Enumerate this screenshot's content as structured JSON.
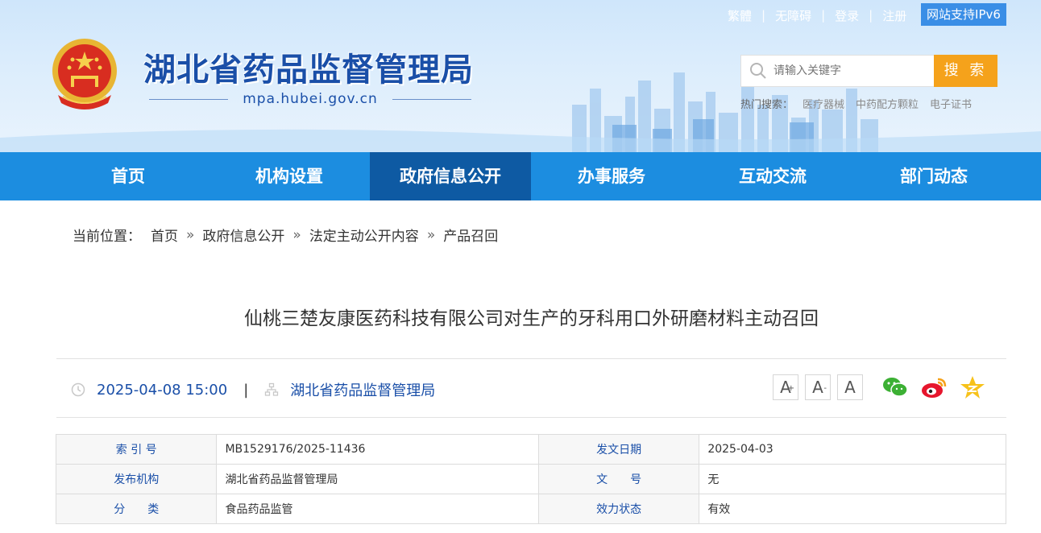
{
  "header": {
    "top_links": [
      "繁體",
      "无障碍",
      "登录",
      "注册"
    ],
    "ipv6": "网站支持IPv6",
    "site_title": "湖北省药品监督管理局",
    "domain": "mpa.hubei.gov.cn",
    "search": {
      "placeholder": "请输入关键字",
      "button": "搜 索"
    },
    "hot": {
      "label": "热门搜索：",
      "items": [
        "医疗器械",
        "中药配方颗粒",
        "电子证书"
      ]
    }
  },
  "nav": [
    "首页",
    "机构设置",
    "政府信息公开",
    "办事服务",
    "互动交流",
    "部门动态"
  ],
  "nav_active": 2,
  "breadcrumb": {
    "label": "当前位置：",
    "items": [
      "首页",
      "政府信息公开",
      "法定主动公开内容",
      "产品召回"
    ],
    "sep": "»"
  },
  "article": {
    "title": "仙桃三楚友康医药科技有限公司对生产的牙科用口外研磨材料主动召回",
    "datetime": "2025-04-08 15:00",
    "pipe": "|",
    "source": "湖北省药品监督管理局"
  },
  "font_buttons": [
    "A",
    "A",
    "A"
  ],
  "font_sup": [
    "+",
    "-"
  ],
  "info_table": [
    {
      "k1": "索 引 号",
      "v1": "MB1529176/2025-11436",
      "k2": "发文日期",
      "v2": "2025-04-03"
    },
    {
      "k1": "发布机构",
      "v1": "湖北省药品监督管理局",
      "k2": "文　　号",
      "v2": "无"
    },
    {
      "k1": "分　　类",
      "v1": "食品药品监管",
      "k2": "效力状态",
      "v2": "有效"
    }
  ],
  "colors": {
    "nav": "#1c8de0",
    "nav_active": "#0e5aa3",
    "search_button": "#f5a21b",
    "title_blue": "#1a4fa8"
  }
}
